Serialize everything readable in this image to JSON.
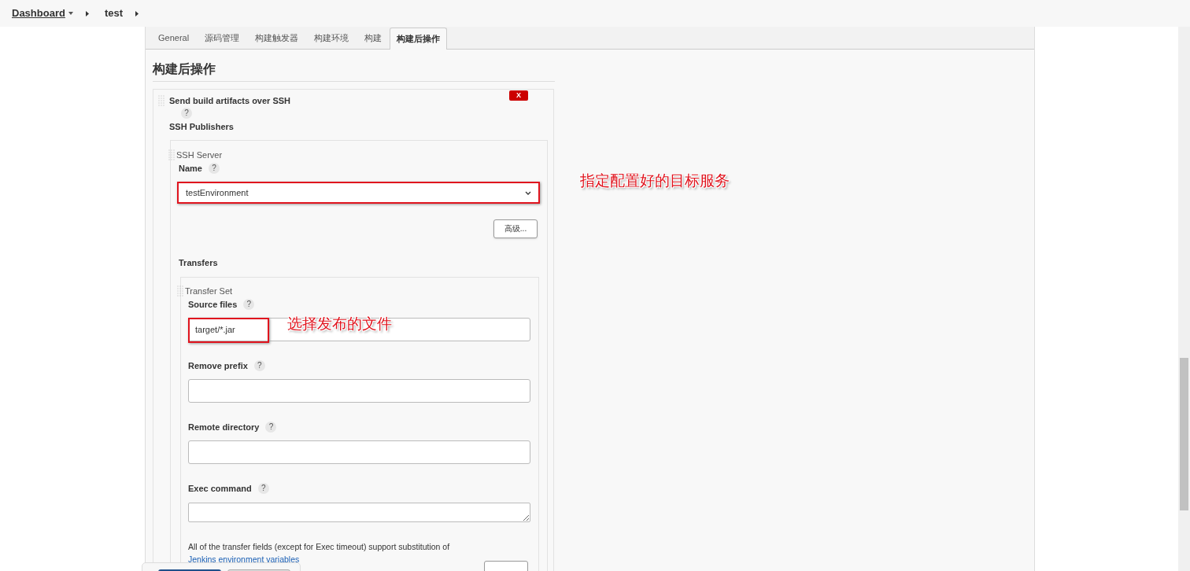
{
  "breadcrumb": [
    {
      "label": "Dashboard",
      "dropdown": true
    },
    {
      "label": "test",
      "dropdown": false
    }
  ],
  "tabs": [
    {
      "label": "General",
      "selected": false
    },
    {
      "label": "源码管理",
      "selected": false
    },
    {
      "label": "构建触发器",
      "selected": false
    },
    {
      "label": "构建环境",
      "selected": false
    },
    {
      "label": "构建",
      "selected": false
    },
    {
      "label": "构建后操作",
      "selected": true
    }
  ],
  "section_title": "构建后操作",
  "publisher": {
    "title": "Send build artifacts over SSH",
    "delete_label": "X",
    "help": "?",
    "subtitle": "SSH Publishers",
    "server": {
      "heading": "SSH Server",
      "name_label": "Name",
      "help": "?",
      "name_value": "testEnvironment",
      "advanced_button": "高级..."
    },
    "transfers_label": "Transfers",
    "transfer_set": {
      "heading": "Transfer Set",
      "fields": [
        {
          "kind": "input",
          "label": "Source files",
          "help": "?",
          "value": "target/*.jar"
        },
        {
          "kind": "input",
          "label": "Remove prefix",
          "help": "?"
        },
        {
          "kind": "input",
          "label": "Remote directory",
          "help": "?"
        },
        {
          "kind": "textarea",
          "label": "Exec command",
          "help": "?"
        }
      ],
      "note": "All of the transfer fields (except for Exec timeout) support substitution of",
      "note_link": "Jenkins environment variables"
    }
  },
  "annotations": [
    {
      "text": "指定配置好的目标服务"
    },
    {
      "text": "选择发布的文件"
    }
  ]
}
